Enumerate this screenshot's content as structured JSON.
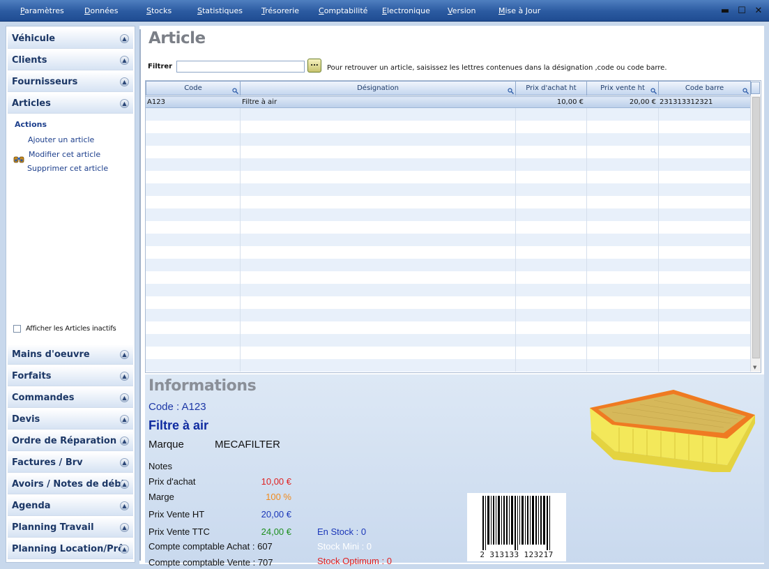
{
  "menu": [
    "Paramètres",
    "Données",
    "Stocks",
    "Statistiques",
    "Trésorerie",
    "Comptabilité",
    "Electronique",
    "Version",
    "Mise à Jour"
  ],
  "window_controls": {
    "minimize": "▬",
    "maximize": "☐",
    "close": "✕"
  },
  "sidebar": {
    "top_sections": [
      "Véhicule",
      "Clients",
      "Fournisseurs",
      "Articles"
    ],
    "actions_title": "Actions",
    "actions": [
      "Ajouter un article",
      "Modifier cet article",
      "Supprimer cet article"
    ],
    "inactive_checkbox_label": "Afficher les Articles inactifs",
    "bottom_sections": [
      "Mains d'oeuvre",
      "Forfaits",
      "Commandes",
      "Devis",
      "Ordre de Réparation",
      "Factures / Brv",
      "Avoirs / Notes de débit",
      "Agenda",
      "Planning Travail",
      "Planning Location/Prêt"
    ]
  },
  "main": {
    "title": "Article",
    "filter_label": "Filtrer",
    "filter_value": "",
    "filter_button": "...",
    "filter_hint": "Pour retrouver un article, saisissez les lettres contenues dans la désignation ,code ou code barre."
  },
  "grid": {
    "columns": [
      "Code",
      "Désignation",
      "Prix d'achat ht",
      "Prix vente ht",
      "Code barre"
    ],
    "rows": [
      {
        "code": "A123",
        "designation": "Filtre à air",
        "prix_achat": "10,00 €",
        "prix_vente": "20,00 €",
        "code_barre": "231313312321"
      }
    ]
  },
  "info": {
    "title": "Informations",
    "code": "Code : A123",
    "name": "Filtre à air",
    "marque_label": "Marque",
    "marque_value": "MECAFILTER",
    "notes_label": "Notes",
    "prix_achat_label": "Prix d'achat",
    "prix_achat_value": "10,00 €",
    "marge_label": "Marge",
    "marge_value": "100 %",
    "prix_ht_label": "Prix Vente HT",
    "prix_ht_value": "20,00 €",
    "prix_ttc_label": "Prix Vente TTC",
    "prix_ttc_value": "24,00 €",
    "compte_achat": "Compte comptable Achat : 607",
    "compte_vente": "Compte comptable Vente : 707",
    "en_stock": "En Stock : 0",
    "stock_mini": "Stock Mini : 0",
    "stock_optimum": "Stock Optimum : 0",
    "barcode_text": "2 313133 123217"
  },
  "colors": {
    "menubar": "#2b5aa0",
    "prix_achat": "#e02020",
    "marge": "#f08a1c",
    "prix_ht": "#1a36b8",
    "prix_ttc": "#1f8f1f",
    "en_stock": "#1a36b8",
    "stock_mini": "#ffffff",
    "stock_optimum": "#e02020"
  }
}
